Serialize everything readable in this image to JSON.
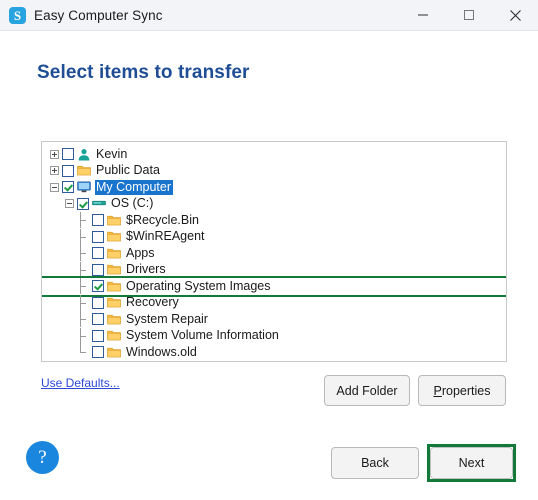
{
  "window": {
    "title": "Easy Computer Sync",
    "app_icon": "app-logo-s",
    "controls": {
      "minimize": "minimize-icon",
      "maximize": "maximize-icon",
      "close": "close-icon"
    }
  },
  "page": {
    "title": "Select items to transfer",
    "title_color": "#1f4e96"
  },
  "tree": {
    "items": [
      {
        "label": "Kevin",
        "depth": 0,
        "expander": "plus",
        "checked": false,
        "icon": "user-icon",
        "selected": false,
        "highlighted": false,
        "last": false
      },
      {
        "label": "Public Data",
        "depth": 0,
        "expander": "plus",
        "checked": false,
        "icon": "folder-icon",
        "selected": false,
        "highlighted": false,
        "last": false
      },
      {
        "label": "My Computer",
        "depth": 0,
        "expander": "minus",
        "checked": true,
        "icon": "monitor-icon",
        "selected": true,
        "highlighted": false,
        "last": false
      },
      {
        "label": "OS (C:)",
        "depth": 1,
        "expander": "minus",
        "checked": true,
        "icon": "drive-icon",
        "selected": false,
        "highlighted": false,
        "last": false
      },
      {
        "label": "$Recycle.Bin",
        "depth": 2,
        "expander": "none",
        "checked": false,
        "icon": "folder-icon",
        "selected": false,
        "highlighted": false,
        "last": false
      },
      {
        "label": "$WinREAgent",
        "depth": 2,
        "expander": "none",
        "checked": false,
        "icon": "folder-icon",
        "selected": false,
        "highlighted": false,
        "last": false
      },
      {
        "label": "Apps",
        "depth": 2,
        "expander": "none",
        "checked": false,
        "icon": "folder-icon",
        "selected": false,
        "highlighted": false,
        "last": false
      },
      {
        "label": "Drivers",
        "depth": 2,
        "expander": "none",
        "checked": false,
        "icon": "folder-icon",
        "selected": false,
        "highlighted": false,
        "last": false
      },
      {
        "label": "Operating System Images",
        "depth": 2,
        "expander": "none",
        "checked": true,
        "icon": "folder-icon",
        "selected": false,
        "highlighted": true,
        "last": false
      },
      {
        "label": "Recovery",
        "depth": 2,
        "expander": "none",
        "checked": false,
        "icon": "folder-icon",
        "selected": false,
        "highlighted": false,
        "last": false
      },
      {
        "label": "System Repair",
        "depth": 2,
        "expander": "none",
        "checked": false,
        "icon": "folder-icon",
        "selected": false,
        "highlighted": false,
        "last": false
      },
      {
        "label": "System Volume Information",
        "depth": 2,
        "expander": "none",
        "checked": false,
        "icon": "folder-icon",
        "selected": false,
        "highlighted": false,
        "last": false
      },
      {
        "label": "Windows.old",
        "depth": 2,
        "expander": "none",
        "checked": false,
        "icon": "folder-icon",
        "selected": false,
        "highlighted": false,
        "last": true
      }
    ],
    "selection_color": "#1874cd",
    "highlight_color": "#117a39"
  },
  "actions": {
    "use_defaults": "Use Defaults...",
    "add_folder": "Add Folder",
    "properties_accel": "P",
    "properties_rest": "roperties",
    "back": "Back",
    "next": "Next",
    "help": "?"
  }
}
